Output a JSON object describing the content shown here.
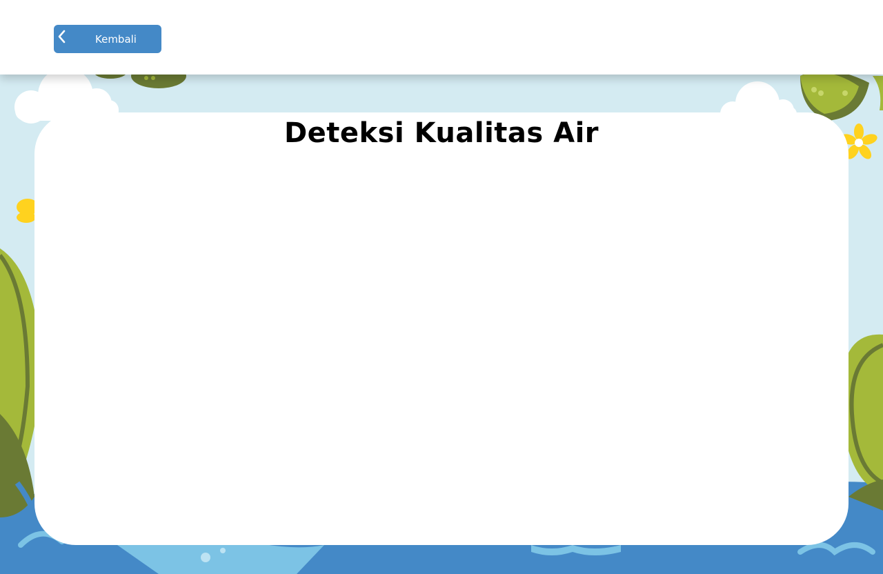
{
  "header": {
    "back_button": {
      "label": "Kembali",
      "icon": "chevron-left-icon"
    }
  },
  "main": {
    "title": "Deteksi Kualitas Air"
  },
  "colors": {
    "sky": "#d4ebf2",
    "water_dark": "#4489c7",
    "water_light": "#7cc3e5",
    "leaf_light": "#a4b93a",
    "leaf_dark": "#6a7a34",
    "flower": "#ffd21f",
    "button": "#4489c7"
  }
}
